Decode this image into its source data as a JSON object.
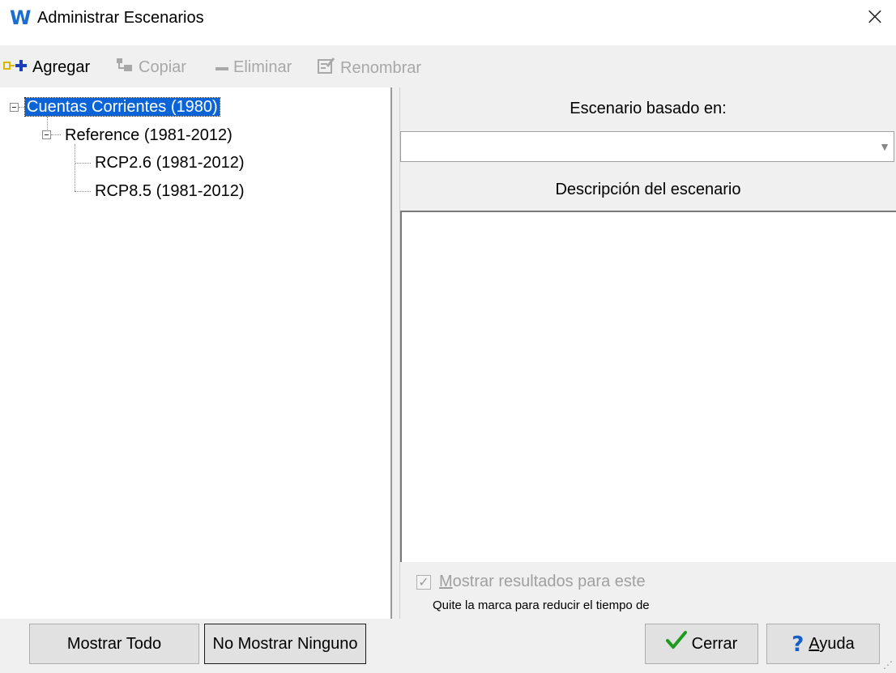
{
  "window": {
    "title": "Administrar Escenarios",
    "app_icon_glyph": "W",
    "close_glyph": "×"
  },
  "toolbar": {
    "add_label": "Agregar",
    "copy_label": "Copiar",
    "delete_label": "Eliminar",
    "rename_label": "Renombrar"
  },
  "tree": {
    "root": "Cuentas Corrientes (1980)",
    "child": "Reference (1981-2012)",
    "leaves": [
      "RCP2.6 (1981-2012)",
      "RCP8.5 (1981-2012)"
    ]
  },
  "right": {
    "based_on_header": "Escenario basado en:",
    "based_on_value": "",
    "description_header": "Descripción del escenario",
    "description_value": "",
    "show_results_label_accel": "M",
    "show_results_label_rest": "ostrar resultados para este",
    "show_results_checked": true,
    "hint": "Quite la marca para reducir el tiempo de"
  },
  "buttons": {
    "show_all": "Mostrar Todo",
    "show_none": "No Mostrar Ninguno",
    "close": "Cerrar",
    "help_accel": "A",
    "help_rest": "yuda"
  },
  "colors": {
    "selection": "#0a64d8",
    "checkmark_green": "#1e9a1e",
    "help_blue": "#1560c8",
    "add_icon_yellow": "#d9b600",
    "add_icon_blue": "#1a3fb8"
  }
}
